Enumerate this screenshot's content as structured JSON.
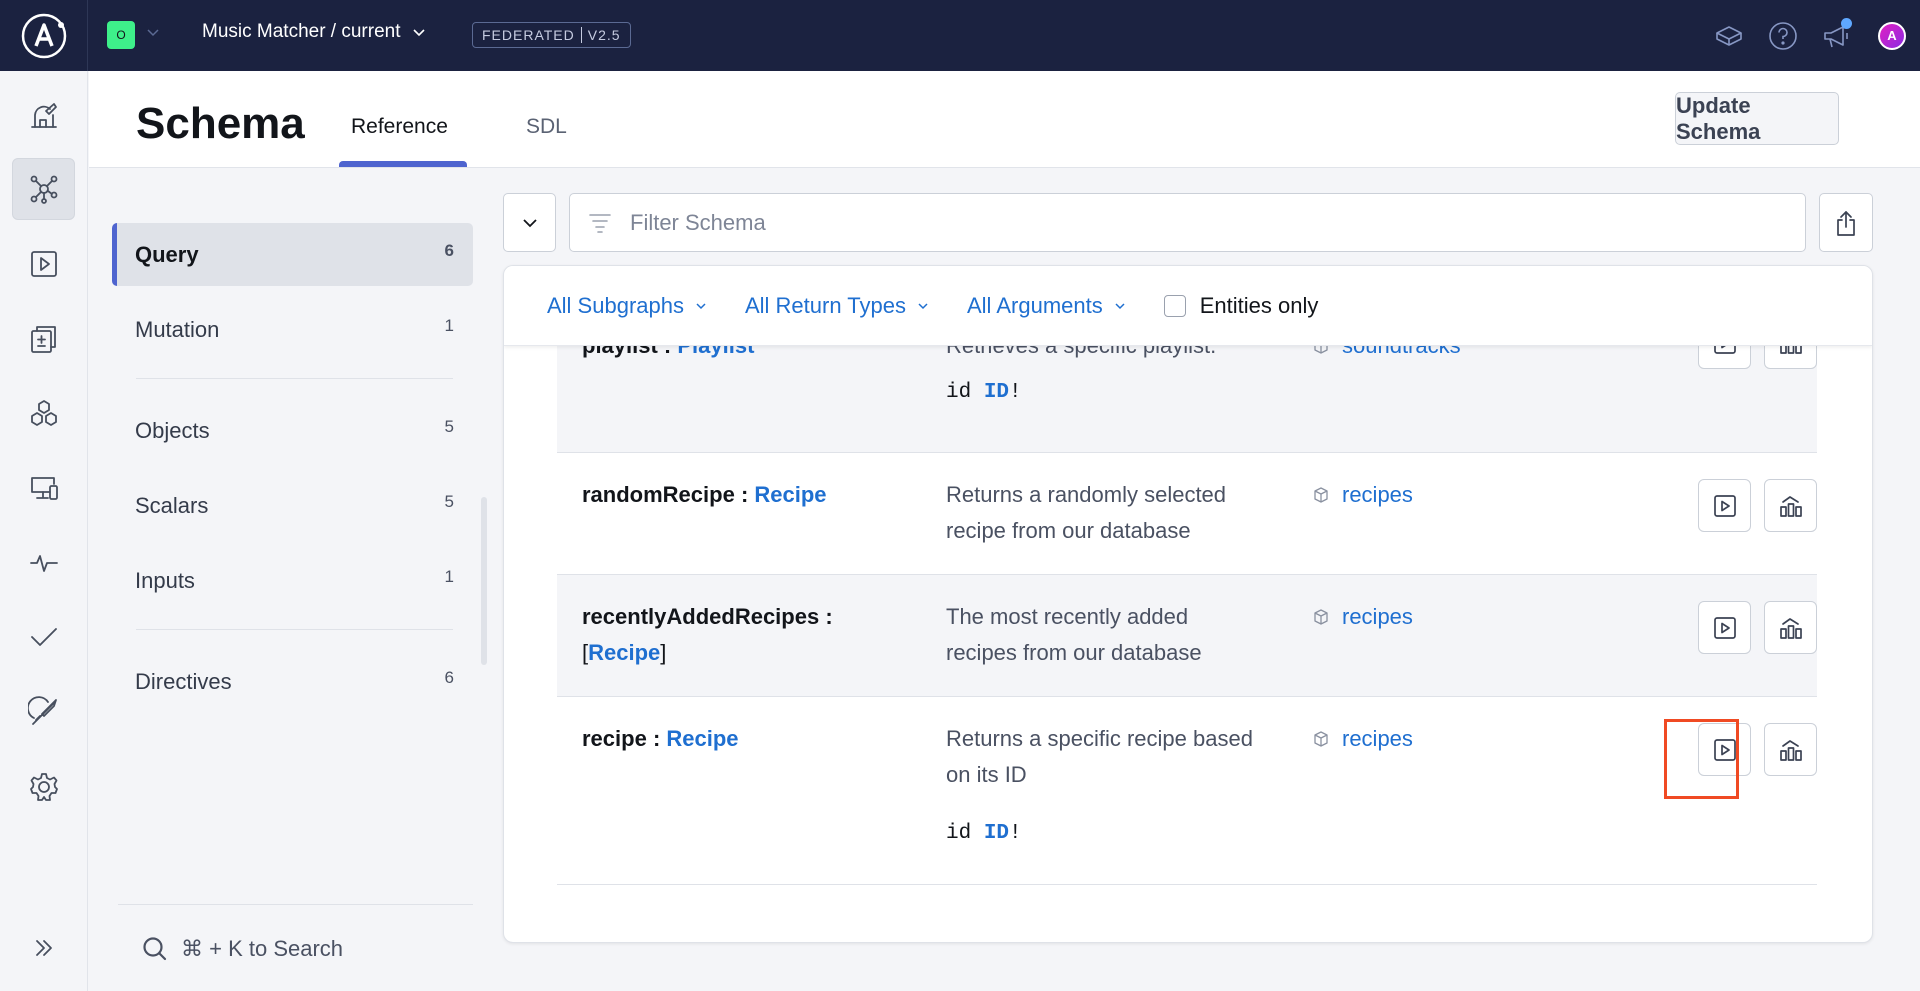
{
  "topbar": {
    "org_initial": "O",
    "graph_title": "Music Matcher / current",
    "badge_left": "FEDERATED",
    "badge_right": "V2.5",
    "icons": [
      "learn-cube-icon",
      "help-icon",
      "announcements-icon",
      "avatar"
    ],
    "avatar_initial": "A"
  },
  "leftnav": {
    "items": [
      {
        "name": "observatory-icon",
        "label": "Observatory"
      },
      {
        "name": "schema-graph-icon",
        "label": "Schema",
        "active": true
      },
      {
        "name": "explorer-play-icon",
        "label": "Explorer"
      },
      {
        "name": "changelog-icon",
        "label": "Changelog"
      },
      {
        "name": "subgraphs-cubes-icon",
        "label": "Subgraphs"
      },
      {
        "name": "clients-devices-icon",
        "label": "Clients"
      },
      {
        "name": "operations-pulse-icon",
        "label": "Operations"
      },
      {
        "name": "checks-icon",
        "label": "Checks"
      },
      {
        "name": "launches-rocket-icon",
        "label": "Launches"
      },
      {
        "name": "settings-gear-icon",
        "label": "Settings"
      }
    ],
    "expand_label": "Expand"
  },
  "header": {
    "title": "Schema",
    "tabs": [
      {
        "label": "Reference",
        "active": true
      },
      {
        "label": "SDL",
        "active": false
      }
    ],
    "update_button": "Update Schema"
  },
  "side_menu": {
    "items": [
      {
        "label": "Query",
        "count": "6",
        "active": true
      },
      {
        "label": "Mutation",
        "count": "1"
      },
      {
        "label": "Objects",
        "count": "5"
      },
      {
        "label": "Scalars",
        "count": "5"
      },
      {
        "label": "Inputs",
        "count": "1"
      },
      {
        "label": "Directives",
        "count": "6"
      }
    ],
    "search_hint": "⌘ + K to Search"
  },
  "filter": {
    "placeholder": "Filter Schema",
    "value": "",
    "dropdowns": [
      "All Subgraphs",
      "All Return Types",
      "All Arguments"
    ],
    "entities_only_label": "Entities only",
    "entities_only_checked": false
  },
  "rows": [
    {
      "field": "playlist",
      "type": "Playlist",
      "list": false,
      "description": "Retrieves a specific playlist.",
      "args": [
        {
          "name": "id",
          "type": "ID",
          "suffix": "!"
        }
      ],
      "subgraph": "soundtracks"
    },
    {
      "field": "randomRecipe",
      "type": "Recipe",
      "list": false,
      "description_lines": [
        "Returns a randomly selected",
        "recipe from our database"
      ],
      "subgraph": "recipes"
    },
    {
      "field": "recentlyAddedRecipes",
      "type": "Recipe",
      "list": true,
      "open_bracket": "[",
      "close_bracket": "]",
      "description_lines": [
        "The most recently added",
        "recipes from our database"
      ],
      "subgraph": "recipes"
    },
    {
      "field": "recipe",
      "type": "Recipe",
      "list": false,
      "description_lines": [
        "Returns a specific recipe based",
        "on its ID"
      ],
      "args": [
        {
          "name": "id",
          "type": "ID",
          "suffix": "!"
        }
      ],
      "subgraph": "recipes"
    }
  ],
  "separator": " : ",
  "colors": {
    "topbar_bg": "#1b2240",
    "accent_blue": "#1f6fd0",
    "tab_indicator": "#4e64cf",
    "org_badge": "#3ef08a",
    "highlight_box": "#f04a23"
  }
}
